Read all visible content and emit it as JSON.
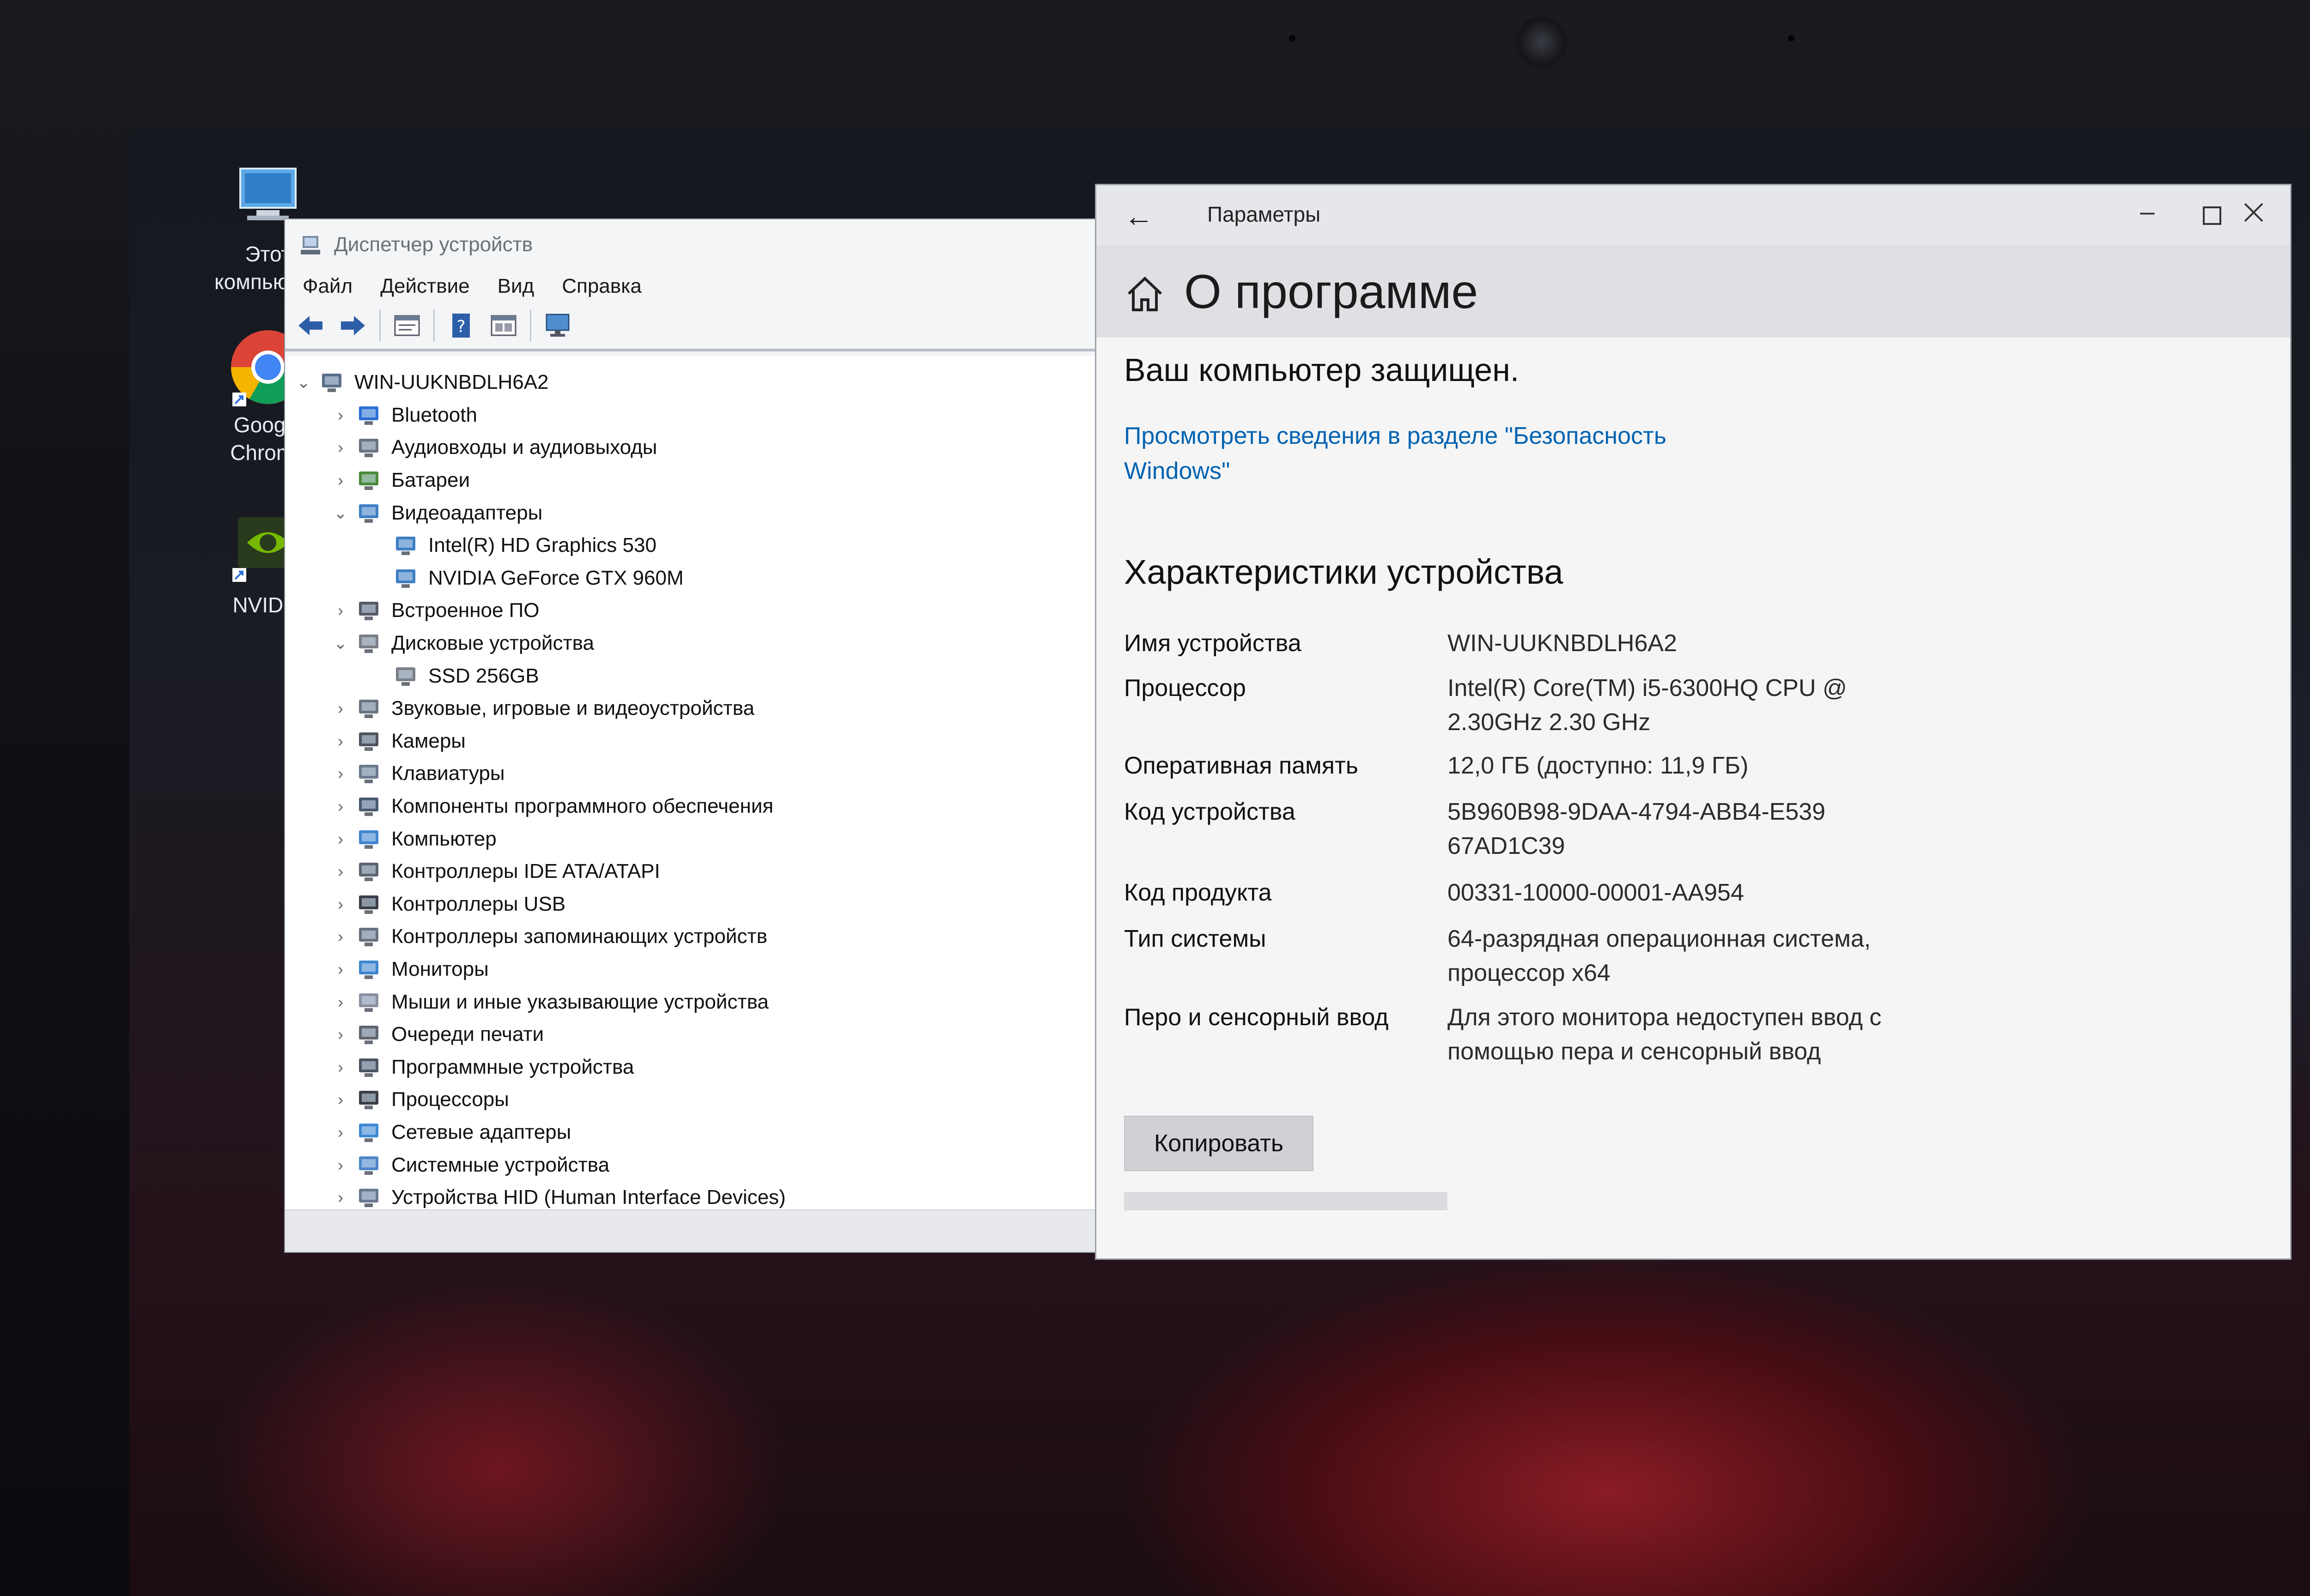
{
  "desktop": {
    "icons": [
      {
        "label": "Этот компьютер",
        "icon": "this-pc-icon"
      },
      {
        "label": "Google Chrome",
        "icon": "chrome-icon"
      },
      {
        "label": "NVIDIA",
        "icon": "nvidia-icon"
      }
    ]
  },
  "device_manager": {
    "title": "Диспетчер устройств",
    "menu": [
      "Файл",
      "Действие",
      "Вид",
      "Справка"
    ],
    "toolbar_icons": [
      "back-arrow-icon",
      "forward-arrow-icon",
      "properties-icon",
      "help-icon",
      "view-icon",
      "monitor-icon"
    ],
    "tree": [
      {
        "label": "WIN-UUKNBDLH6A2",
        "level": 0,
        "state": "expanded",
        "icon": "computer-icon"
      },
      {
        "label": "Bluetooth",
        "level": 1,
        "state": "collapsed",
        "icon": "bluetooth-icon"
      },
      {
        "label": "Аудиовходы и аудиовыходы",
        "level": 1,
        "state": "collapsed",
        "icon": "speaker-icon"
      },
      {
        "label": "Батареи",
        "level": 1,
        "state": "collapsed",
        "icon": "battery-icon"
      },
      {
        "label": "Видеоадаптеры",
        "level": 1,
        "state": "expanded",
        "icon": "display-adapter-icon"
      },
      {
        "label": "Intel(R) HD Graphics 530",
        "level": 2,
        "state": "leaf",
        "icon": "display-adapter-icon"
      },
      {
        "label": "NVIDIA GeForce GTX 960M",
        "level": 2,
        "state": "leaf",
        "icon": "display-adapter-icon"
      },
      {
        "label": "Встроенное ПО",
        "level": 1,
        "state": "collapsed",
        "icon": "firmware-icon"
      },
      {
        "label": "Дисковые устройства",
        "level": 1,
        "state": "expanded",
        "icon": "disk-icon"
      },
      {
        "label": "SSD 256GB",
        "level": 2,
        "state": "leaf",
        "icon": "disk-icon"
      },
      {
        "label": "Звуковые, игровые и видеоустройства",
        "level": 1,
        "state": "collapsed",
        "icon": "speaker-icon"
      },
      {
        "label": "Камеры",
        "level": 1,
        "state": "collapsed",
        "icon": "camera-icon"
      },
      {
        "label": "Клавиатуры",
        "level": 1,
        "state": "collapsed",
        "icon": "keyboard-icon"
      },
      {
        "label": "Компоненты программного обеспечения",
        "level": 1,
        "state": "collapsed",
        "icon": "software-component-icon"
      },
      {
        "label": "Компьютер",
        "level": 1,
        "state": "collapsed",
        "icon": "monitor-icon"
      },
      {
        "label": "Контроллеры IDE ATA/ATAPI",
        "level": 1,
        "state": "collapsed",
        "icon": "ide-controller-icon"
      },
      {
        "label": "Контроллеры USB",
        "level": 1,
        "state": "collapsed",
        "icon": "usb-icon"
      },
      {
        "label": "Контроллеры запоминающих устройств",
        "level": 1,
        "state": "collapsed",
        "icon": "storage-controller-icon"
      },
      {
        "label": "Мониторы",
        "level": 1,
        "state": "collapsed",
        "icon": "monitor-icon"
      },
      {
        "label": "Мыши и иные указывающие устройства",
        "level": 1,
        "state": "collapsed",
        "icon": "mouse-icon"
      },
      {
        "label": "Очереди печати",
        "level": 1,
        "state": "collapsed",
        "icon": "printer-icon"
      },
      {
        "label": "Программные устройства",
        "level": 1,
        "state": "collapsed",
        "icon": "software-device-icon"
      },
      {
        "label": "Процессоры",
        "level": 1,
        "state": "collapsed",
        "icon": "processor-icon"
      },
      {
        "label": "Сетевые адаптеры",
        "level": 1,
        "state": "collapsed",
        "icon": "network-adapter-icon"
      },
      {
        "label": "Системные устройства",
        "level": 1,
        "state": "collapsed",
        "icon": "system-device-icon"
      },
      {
        "label": "Устройства HID (Human Interface Devices)",
        "level": 1,
        "state": "collapsed",
        "icon": "hid-icon"
      }
    ]
  },
  "settings": {
    "title": "Параметры",
    "page_title": "О программе",
    "protection_status": "Ваш компьютер защищен.",
    "security_link": "Просмотреть сведения в разделе \"Безопасность Windows\"",
    "specs_heading": "Характеристики устройства",
    "specs": [
      {
        "key": "Имя устройства",
        "value": "WIN-UUKNBDLH6A2"
      },
      {
        "key": "Процессор",
        "value": "Intel(R) Core(TM) i5-6300HQ CPU @ 2.30GHz   2.30 GHz"
      },
      {
        "key": "Оперативная память",
        "value": "12,0 ГБ (доступно: 11,9 ГБ)"
      },
      {
        "key": "Код устройства",
        "value": "5B960B98-9DAA-4794-ABB4-E53967AD1C39"
      },
      {
        "key": "Код продукта",
        "value": "00331-10000-00001-AA954"
      },
      {
        "key": "Тип системы",
        "value": "64-разрядная операционная система, процессор x64"
      },
      {
        "key": "Перо и сенсорный ввод",
        "value": "Для этого монитора недоступен ввод с помощью пера и сенсорный ввод"
      }
    ],
    "copy_button": "Копировать"
  },
  "colors": {
    "link": "#0063b1",
    "wallpaper_red": "#8a1c24"
  }
}
